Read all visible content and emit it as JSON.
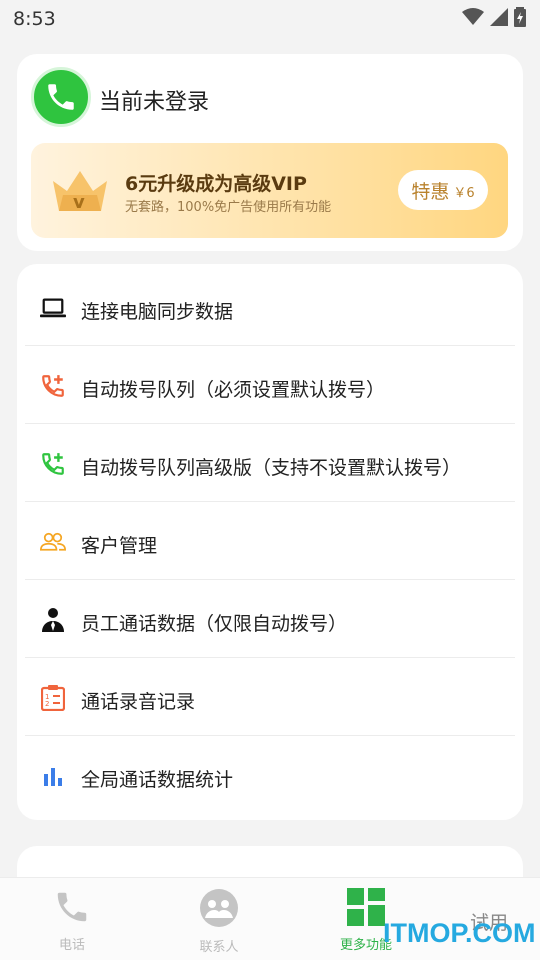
{
  "status_bar": {
    "time": "8:53"
  },
  "profile": {
    "login_status": "当前未登录",
    "vip": {
      "title": "6元升级成为高级VIP",
      "subtitle": "无套路，100%免广告使用所有功能",
      "button_label": "特惠",
      "button_price": "￥6",
      "crown_letter": "v"
    }
  },
  "menu": [
    {
      "label": "连接电脑同步数据",
      "icon": "laptop-icon"
    },
    {
      "label": "自动拨号队列（必须设置默认拨号）",
      "icon": "phone-add-red-icon"
    },
    {
      "label": "自动拨号队列高级版（支持不设置默认拨号）",
      "icon": "phone-add-green-icon"
    },
    {
      "label": "客户管理",
      "icon": "customers-icon"
    },
    {
      "label": "员工通话数据（仅限自动拨号）",
      "icon": "employee-icon"
    },
    {
      "label": "通话录音记录",
      "icon": "clipboard-list-icon"
    },
    {
      "label": "全局通话数据统计",
      "icon": "bar-chart-icon"
    }
  ],
  "bottom_nav": [
    {
      "label": "电话",
      "icon": "phone-icon",
      "active": false
    },
    {
      "label": "联系人",
      "icon": "contacts-icon",
      "active": false
    },
    {
      "label": "更多功能",
      "icon": "grid-icon",
      "active": true
    }
  ],
  "bottom_nav_extra": "试用",
  "watermark": "ITMOP.COM",
  "colors": {
    "accent_green": "#2fc43f",
    "vip_gold": "#b9822d",
    "icon_red": "#f0643c",
    "icon_orange": "#f5a623",
    "icon_blue": "#3b7de8"
  }
}
